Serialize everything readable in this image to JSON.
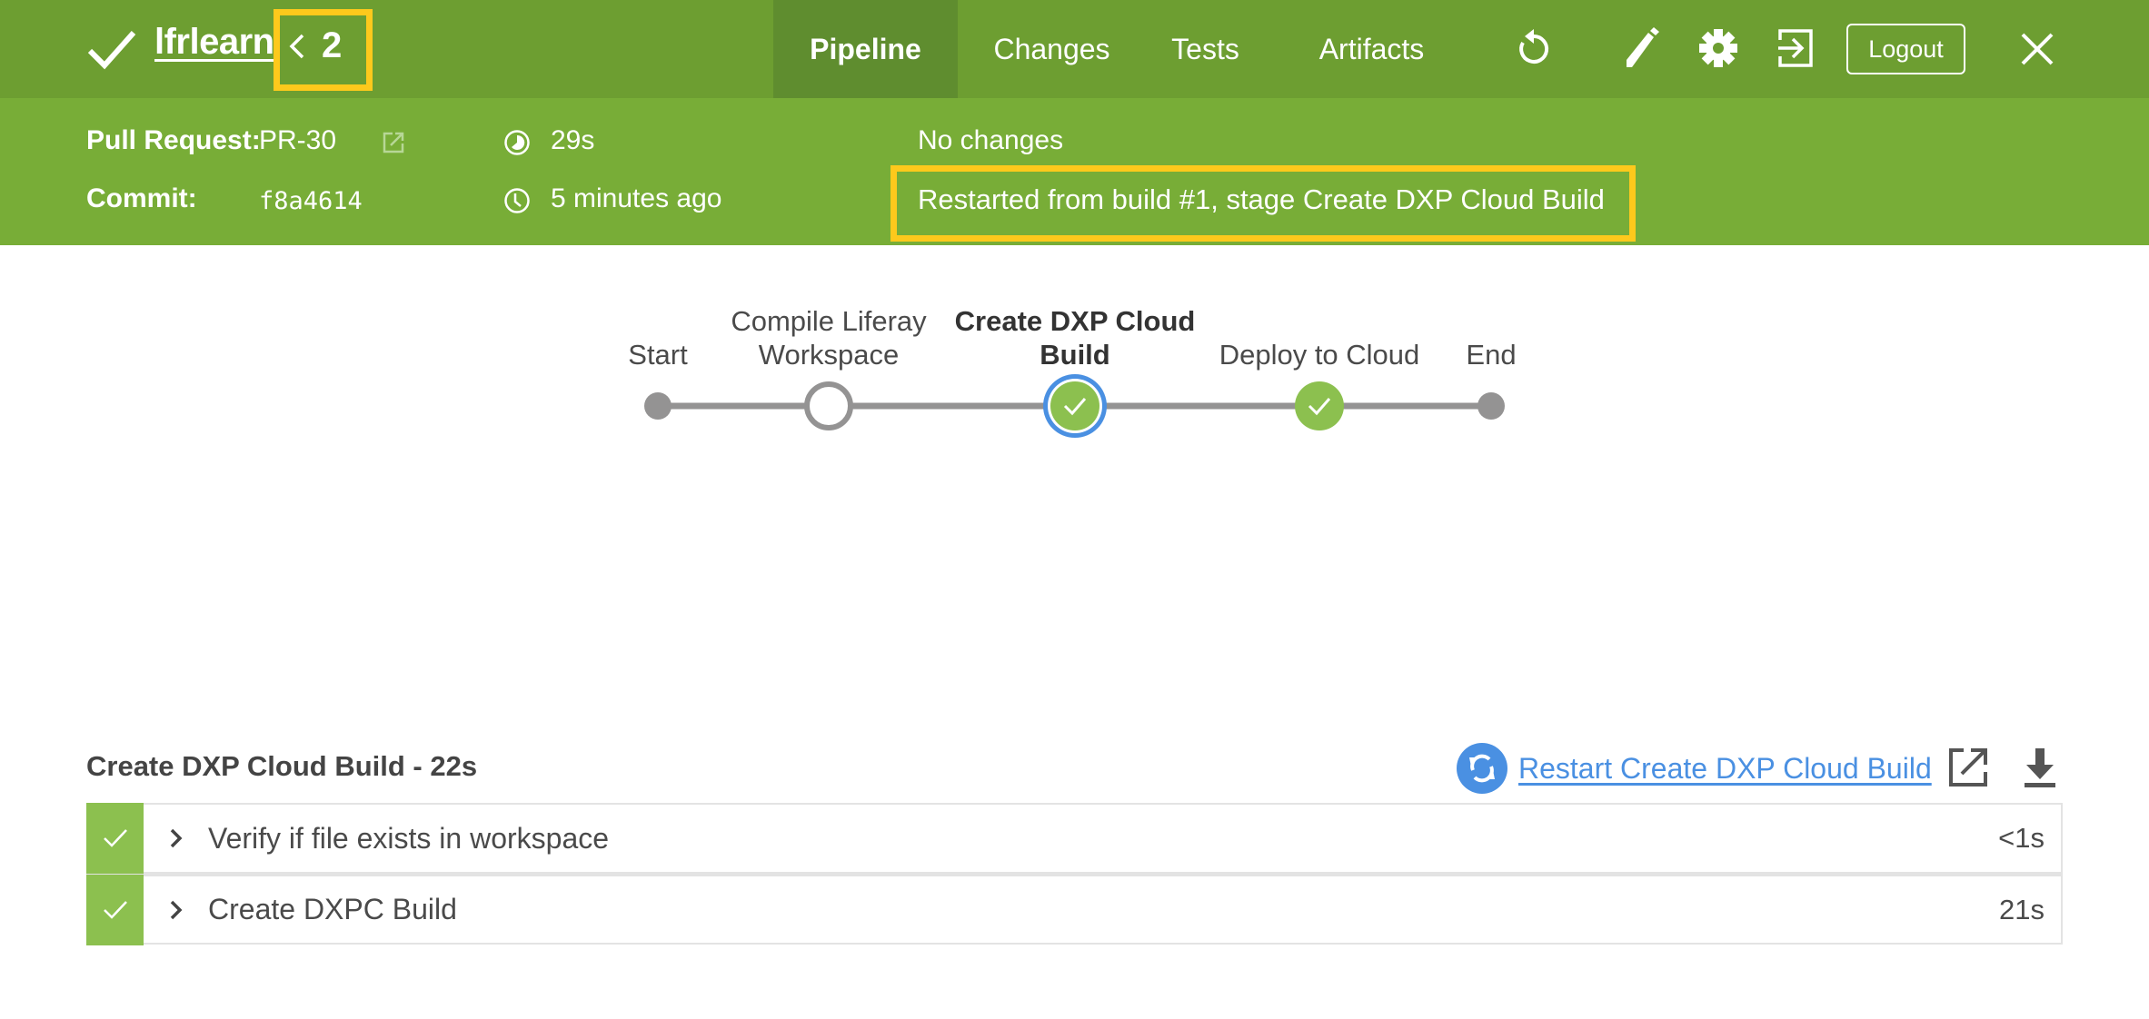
{
  "header": {
    "status_icon": "check-icon",
    "job_name": "lfrlearn",
    "run_number": "2",
    "tabs": [
      {
        "label": "Pipeline",
        "active": true
      },
      {
        "label": "Changes",
        "active": false
      },
      {
        "label": "Tests",
        "active": false
      },
      {
        "label": "Artifacts",
        "active": false
      }
    ],
    "icons": [
      "reload-icon",
      "pencil-icon",
      "gear-icon",
      "login-icon"
    ],
    "logout_label": "Logout",
    "close_icon": "close-icon"
  },
  "summary": {
    "pull_request_label": "Pull Request:",
    "pull_request_value": "PR-30",
    "commit_label": "Commit:",
    "commit_value": "f8a4614",
    "duration": "29s",
    "started": "5 minutes ago",
    "changes": "No changes",
    "cause": "Restarted from build #1, stage Create DXP Cloud Build"
  },
  "pipeline": {
    "stages": [
      {
        "label": "Start",
        "type": "terminal",
        "state": "start"
      },
      {
        "label": "Compile Liferay Workspace",
        "type": "stage",
        "state": "not-built"
      },
      {
        "label": "Create DXP Cloud Build",
        "type": "stage",
        "state": "success",
        "selected": true
      },
      {
        "label": "Deploy to Cloud",
        "type": "stage",
        "state": "success"
      },
      {
        "label": "End",
        "type": "terminal",
        "state": "end"
      }
    ],
    "colors": {
      "connector": "#949393",
      "success": "#8cc04f",
      "selected_ring": "#4a90e2",
      "not_built": "#949393"
    }
  },
  "step_panel": {
    "title": "Create DXP Cloud Build - 22s",
    "restart_link": "Restart Create DXP Cloud Build",
    "steps": [
      {
        "name": "Verify if file exists in workspace",
        "duration": "<1s",
        "status": "success"
      },
      {
        "name": "Create DXPC Build",
        "duration": "21s",
        "status": "success"
      }
    ]
  },
  "colors": {
    "header_bg": "#6d9e31",
    "active_tab_bg": "#5f8d2f",
    "subheader_bg": "#78ad37",
    "highlight": "#fdc91c",
    "link": "#4a90e2"
  }
}
